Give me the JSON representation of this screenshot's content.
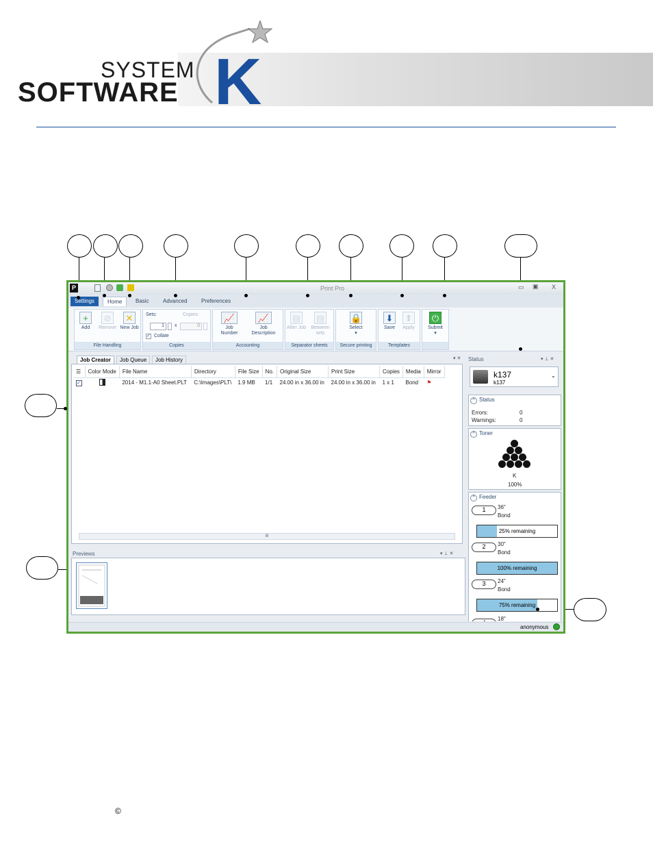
{
  "logo": {
    "system": "SYSTEM",
    "software": "SOFTWARE",
    "k": "K"
  },
  "footer": {
    "copyright": "©"
  },
  "app": {
    "title": "Print Pro",
    "tabs": [
      "Settings",
      "Home",
      "Basic",
      "Advanced",
      "Preferences"
    ],
    "ribbon": {
      "file_handling": {
        "label": "File Handling",
        "add": "Add",
        "remove": "Remove",
        "new_job": "New Job"
      },
      "copies": {
        "label": "Copies",
        "sets": "Sets:",
        "copies": "Copies:",
        "sets_value": "1",
        "x": "x",
        "copies_value": "0",
        "collate": "Collate"
      },
      "accounting": {
        "label": "Accounting",
        "job_number": "Job Number",
        "job_description": "Job Description"
      },
      "separator": {
        "label": "Separator sheets",
        "after_job": "After Job",
        "between_sets": "Between sets"
      },
      "secure": {
        "label": "Secure printing",
        "select": "Select"
      },
      "templates": {
        "label": "Templates",
        "save": "Save",
        "apply": "Apply"
      },
      "submit": {
        "label": "Submit"
      }
    },
    "job_tabs": [
      "Job Creator",
      "Job Queue",
      "Job History"
    ],
    "columns": [
      "Color Mode",
      "File Name",
      "Directory",
      "File Size",
      "No.",
      "Original Size",
      "Print Size",
      "Copies",
      "Media",
      "Mirror"
    ],
    "rows": [
      {
        "file_name": "2014 - M1.1-A0 Sheet.PLT",
        "directory": "C:\\Images\\PLT\\",
        "file_size": "1.9 MB",
        "no": "1/1",
        "original_size": "24.00 in x 36.00 in",
        "print_size": "24.00 in x 36.00 in",
        "copies": "1 x 1",
        "media": "Bond"
      }
    ],
    "scroll_label": "III",
    "previews_title": "Previews",
    "status_title": "Status",
    "printer": {
      "name": "k137",
      "sub": "k137"
    },
    "status": {
      "title": "Status",
      "errors_label": "Errors:",
      "errors": "0",
      "warnings_label": "Warnings:",
      "warnings": "0"
    },
    "toner": {
      "title": "Toner",
      "color": "K",
      "level": "100%"
    },
    "feeder": {
      "title": "Feeder",
      "rolls": [
        {
          "num": "1",
          "size": "36\"",
          "media": "Bond",
          "remaining": "25% remaining",
          "fraction": 0.25
        },
        {
          "num": "2",
          "size": "30\"",
          "media": "Bond",
          "remaining": "100% remaining",
          "fraction": 1.0
        },
        {
          "num": "3",
          "size": "24\"",
          "media": "Bond",
          "remaining": "75% remaining",
          "fraction": 0.75
        },
        {
          "num": "4",
          "size": "18\""
        }
      ]
    },
    "user": "anonymous"
  },
  "colors": {
    "accent": "#1f5ea8",
    "brand": "#1a4f9e",
    "frame": "#5aa33a",
    "fill": "#8fc6e4"
  }
}
